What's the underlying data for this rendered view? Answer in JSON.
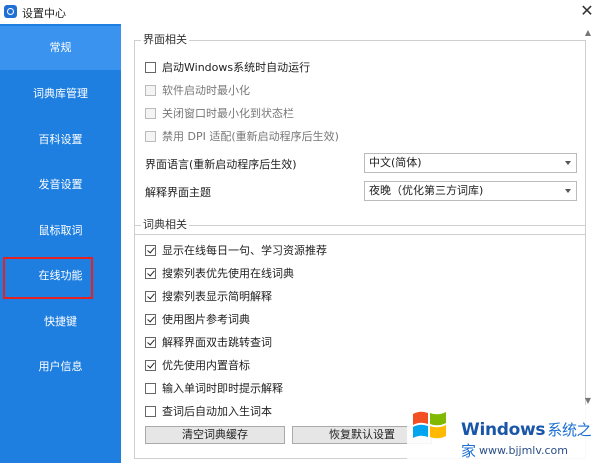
{
  "window": {
    "title": "设置中心",
    "close_glyph": "✕"
  },
  "sidebar": {
    "items": [
      {
        "label": "常规",
        "active": true
      },
      {
        "label": "词典库管理"
      },
      {
        "label": "百科设置"
      },
      {
        "label": "发音设置"
      },
      {
        "label": "鼠标取词"
      },
      {
        "label": "在线功能",
        "highlighted": true
      },
      {
        "label": "快捷键"
      },
      {
        "label": "用户信息"
      }
    ]
  },
  "ui_group": {
    "title": "界面相关",
    "options": [
      {
        "label": "启动Windows系统时自动运行",
        "checked": false
      },
      {
        "label": "软件启动时最小化",
        "checked": false,
        "disabled": true
      },
      {
        "label": "关闭窗口时最小化到状态栏",
        "checked": false,
        "disabled": true
      },
      {
        "label": "禁用 DPI 适配(重新启动程序后生效)",
        "checked": false,
        "disabled": true
      }
    ],
    "language": {
      "label": "界面语言(重新启动程序后生效)",
      "value": "中文(简体)"
    },
    "theme": {
      "label": "解释界面主题",
      "value": "夜晚（优化第三方词库)"
    }
  },
  "dict_group": {
    "title": "词典相关",
    "options": [
      {
        "label": "显示在线每日一句、学习资源推荐",
        "checked": true
      },
      {
        "label": "搜索列表优先使用在线词典",
        "checked": true
      },
      {
        "label": "搜索列表显示简明解释",
        "checked": true
      },
      {
        "label": "使用图片参考词典",
        "checked": true
      },
      {
        "label": "解释界面双击跳转查词",
        "checked": true
      },
      {
        "label": "优先使用内置音标",
        "checked": true
      },
      {
        "label": "输入单词时即时提示解释",
        "checked": false
      },
      {
        "label": "查词后自动加入生词本",
        "checked": false
      }
    ]
  },
  "buttons": {
    "clear_cache": "清空词典缓存",
    "restore_defaults": "恢复默认设置"
  },
  "scroll": {
    "up": "▲",
    "down": "▼"
  },
  "watermark": {
    "brand": "Windows",
    "brand_cn": "系统之家",
    "url": "www.bjjmlv.com",
    "colors": {
      "red": "#f25022",
      "green": "#7fba00",
      "blue": "#00a4ef",
      "yellow": "#ffb900"
    }
  },
  "colors": {
    "sidebar": "#1f7fe0",
    "sidebar_active": "#3a93ee",
    "highlight": "#e52222"
  }
}
